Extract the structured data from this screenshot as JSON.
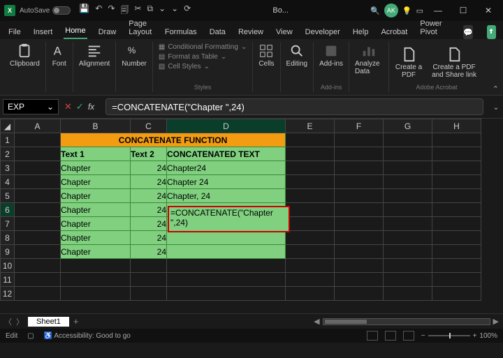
{
  "title": {
    "autosave": "AutoSave",
    "doc": "Bo...",
    "avatar": "AK"
  },
  "qat": {
    "save": "💾",
    "undo": "↶",
    "redo": "↷",
    "new": "🗐",
    "cut": "✂",
    "copy": "⧉",
    "paste": "📋",
    "drop1": "⌄",
    "drop2": "⌄",
    "refresh": "⟳"
  },
  "tabs": {
    "file": "File",
    "insert": "Insert",
    "home": "Home",
    "draw": "Draw",
    "layout": "Page Layout",
    "formulas": "Formulas",
    "data": "Data",
    "review": "Review",
    "view": "View",
    "developer": "Developer",
    "help": "Help",
    "acrobat": "Acrobat",
    "powerpivot": "Power Pivot"
  },
  "ribbon": {
    "clipboard": "Clipboard",
    "font": "Font",
    "alignment": "Alignment",
    "number": "Number",
    "cond": "Conditional Formatting",
    "table": "Format as Table",
    "cellstyles": "Cell Styles",
    "styles": "Styles",
    "cells": "Cells",
    "editing": "Editing",
    "addins": "Add-ins",
    "analyze": "Analyze Data",
    "createpdf": "Create a PDF",
    "createshare": "Create a PDF and Share link",
    "adobe": "Adobe Acrobat"
  },
  "namebox": "EXP",
  "formula": "=CONCATENATE(\"Chapter \",24)",
  "cols": {
    "A": "A",
    "B": "B",
    "C": "C",
    "D": "D",
    "E": "E",
    "F": "F",
    "G": "G",
    "H": "H"
  },
  "sheet": {
    "title": "CONCATENATE FUNCTION",
    "h1": "Text 1",
    "h2": "Text 2",
    "h3": "CONCATENATED TEXT",
    "rows": [
      {
        "b": "Chapter",
        "c": "24",
        "d": "Chapter24"
      },
      {
        "b": "Chapter",
        "c": "24",
        "d": "Chapter 24"
      },
      {
        "b": "Chapter",
        "c": "24",
        "d": "Chapter, 24"
      },
      {
        "b": "Chapter",
        "c": "24",
        "d": ""
      },
      {
        "b": "Chapter",
        "c": "24",
        "d": ""
      },
      {
        "b": "Chapter",
        "c": "24",
        "d": ""
      },
      {
        "b": "Chapter",
        "c": "24",
        "d": ""
      }
    ],
    "edit": "=CONCATENATE(\"Chapter \",24)"
  },
  "sheettab": "Sheet1",
  "status": {
    "mode": "Edit",
    "acc": "Accessibility: Good to go",
    "zoom": "100%"
  }
}
